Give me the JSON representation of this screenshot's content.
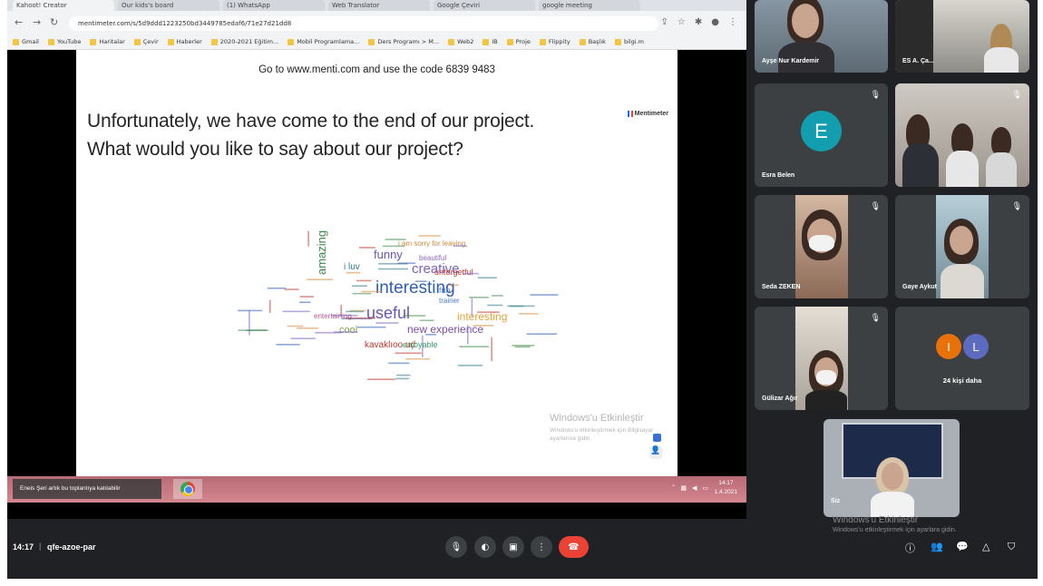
{
  "browser": {
    "tabs": [
      "Kahoot! Creator",
      "Our kids's board",
      "(1) WhatsApp",
      "Web Translator",
      "Google Çeviri",
      "google meeting"
    ],
    "url": "mentimeter.com/s/5d9ddd1223250bd3449785edaf6/71e27d21dd8",
    "bookmarks": [
      "Gmail",
      "YouTube",
      "Haritalar",
      "Çevir",
      "Haberler",
      "2020-2021 Eğitim...",
      "Mobil Programlama...",
      "Ders Programı > M...",
      "Web2",
      "IB",
      "Proje",
      "Flippity",
      "Başlık",
      "bilgi.m"
    ]
  },
  "slide": {
    "instruction": "Go to www.menti.com and use the code 6839 9483",
    "question_line1": "Unfortunately, we have come to the end of our project.",
    "question_line2": "What would you like to say about our project?",
    "brand": "Mentimeter",
    "word_cloud": [
      {
        "word": "interesting",
        "color": "#2f5fb3"
      },
      {
        "word": "creative",
        "color": "#7a62c2"
      },
      {
        "word": "useful",
        "color": "#6a55b8"
      },
      {
        "word": "amazing",
        "color": "#3f8a4a"
      },
      {
        "word": "interesting",
        "color": "#e0a53a"
      },
      {
        "word": "funny",
        "color": "#6a55b8"
      },
      {
        "word": "new experience",
        "color": "#7a4fa8"
      },
      {
        "word": "kavaklıoo ud",
        "color": "#c0392b"
      },
      {
        "word": "i luv",
        "color": "#2f7a8a"
      },
      {
        "word": "cool",
        "color": "#7aa84a"
      },
      {
        "word": "enjoyable",
        "color": "#3a9a6a"
      },
      {
        "word": "unforgetful",
        "color": "#c0392b"
      },
      {
        "word": "fun",
        "color": "#5a8ad0"
      },
      {
        "word": "beautiful",
        "color": "#8a6abf"
      },
      {
        "word": "i am sorry for leaving",
        "color": "#d38a3a"
      },
      {
        "word": "trainer",
        "color": "#4a7ac0"
      },
      {
        "word": "entertaining",
        "color": "#b55a8a"
      }
    ],
    "windows_activate_title": "Windows'u Etkinleştir",
    "windows_activate_sub": "Windows'u etkinleştirmek için Bilgisayar ayarlarına gidin."
  },
  "taskbar": {
    "toast": "Eneis Şeri artık bu toplantıya katılabilir",
    "clock_time": "14:17",
    "clock_date": "1.4.2021"
  },
  "participants": [
    {
      "name": "Ayşe Nur Kardemir",
      "kind": "video"
    },
    {
      "name": "ES A. Ça...",
      "kind": "video"
    },
    {
      "name": "Esra Belen",
      "kind": "avatar",
      "initial": "E",
      "color": "#129eaf"
    },
    {
      "name": "",
      "kind": "video"
    },
    {
      "name": "Seda ZEKEN",
      "kind": "video"
    },
    {
      "name": "Gaye Aykut",
      "kind": "video"
    },
    {
      "name": "Gülizar Ağır",
      "kind": "video"
    },
    {
      "name": "24 kişi daha",
      "kind": "more",
      "initials": [
        "I",
        "L"
      ],
      "colors": [
        "#e8710a",
        "#5c6bc0"
      ]
    },
    {
      "name": "Siz",
      "kind": "self"
    }
  ],
  "meeting": {
    "time": "14:17",
    "code": "qfe-azoe-par",
    "controls": [
      "microphone",
      "camera",
      "captions",
      "present",
      "more",
      "leave"
    ],
    "right_controls": [
      "info",
      "people",
      "chat",
      "activities",
      "host-controls"
    ]
  },
  "windows_watermark": {
    "title": "Windows'u Etkinleştir",
    "sub": "Windows'u etkinleştirmek için ayarlara gidin."
  },
  "colors": {
    "meet_bg": "#202124",
    "tile_bg": "#3c4043",
    "end_call": "#ea4335"
  }
}
